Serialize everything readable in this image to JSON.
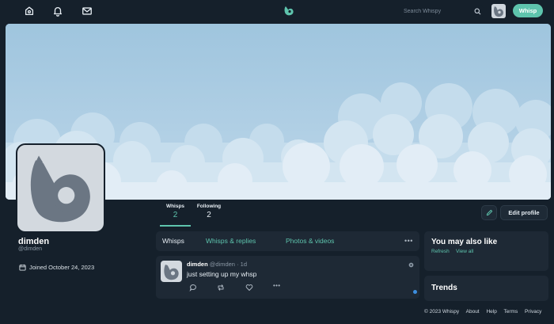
{
  "header": {
    "icons": [
      "home-icon",
      "bell-icon",
      "mail-icon"
    ],
    "logo_icon": "whale-logo-icon",
    "search": {
      "placeholder": "Search Whispy"
    },
    "whisp_button": "Whisp"
  },
  "profile": {
    "display_name": "dimden",
    "handle": "@dimden",
    "joined": "Joined October 24, 2023",
    "stats": {
      "whisps_label": "Whisps",
      "whisps_value": "2",
      "following_label": "Following",
      "following_value": "2"
    },
    "edit_button": "Edit profile"
  },
  "tabs": {
    "items": [
      "Whisps",
      "Whisps & replies",
      "Photos & videos"
    ],
    "active": "Whisps",
    "more": "•••"
  },
  "posts": [
    {
      "name": "dimden",
      "handle": "@dimden",
      "separator": "·",
      "time": "1d",
      "text": "just setting up my whsp",
      "actions": [
        "reply-icon",
        "rewhisp-icon",
        "like-icon",
        "more-icon"
      ],
      "more": "•••"
    }
  ],
  "sidebar": {
    "suggest_title": "You may also like",
    "refresh": "Refresh",
    "view_all": "View all",
    "trends_title": "Trends"
  },
  "footer": {
    "copyright": "© 2023 Whispy",
    "links": [
      "About",
      "Help",
      "Terms",
      "Privacy"
    ]
  },
  "colors": {
    "background": "#15202b",
    "panel": "#1e2935",
    "accent": "#5ec4ad",
    "banner_sky": "#a2c7df",
    "cloud": "#dce9f3"
  }
}
